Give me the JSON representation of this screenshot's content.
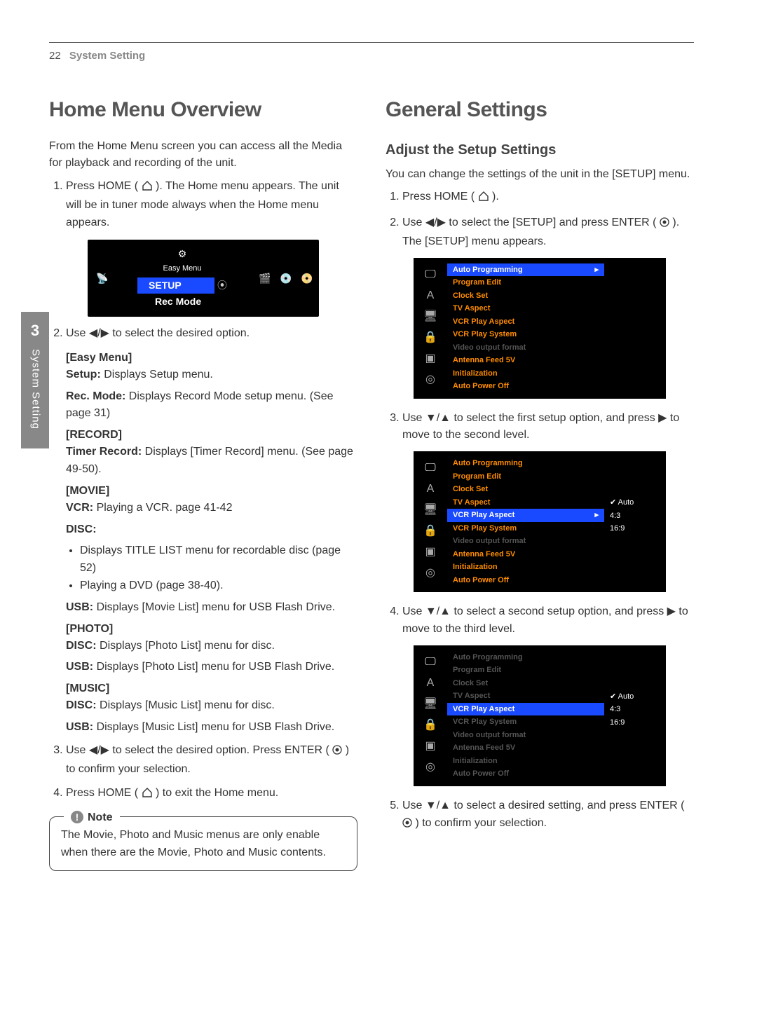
{
  "header": {
    "page_number": "22",
    "section": "System Setting"
  },
  "side_tab": {
    "number": "3",
    "label": "System Setting"
  },
  "left": {
    "h1": "Home Menu Overview",
    "intro": "From the Home Menu screen you can access all the Media for playback and recording of the unit.",
    "step1_a": "Press HOME (",
    "step1_b": "). The Home menu appears. The unit will be in tuner mode always when the Home menu appears.",
    "osd": {
      "easy_menu_label": "Easy Menu",
      "setup": "SETUP",
      "rec_mode": "Rec Mode"
    },
    "step2": "Use ◀/▶ to select the desired option.",
    "easy_menu": {
      "title": "[Easy Menu]",
      "setup_b": "Setup:",
      "setup_t": "Displays Setup menu.",
      "rec_b": "Rec. Mode:",
      "rec_t": "Displays Record Mode setup menu. (See page 31)"
    },
    "record": {
      "title": "[RECORD]",
      "timer_b": "Timer Record:",
      "timer_t": "Displays [Timer Record] menu. (See page 49-50)."
    },
    "movie": {
      "title": "[MOVIE]",
      "vcr_b": "VCR:",
      "vcr_t": "Playing a VCR. page 41-42",
      "disc_b": "DISC:",
      "disc_li1": "Displays TITLE LIST menu for recordable disc (page 52)",
      "disc_li2": "Playing a DVD (page 38-40).",
      "usb_b": "USB:",
      "usb_t": "Displays [Movie List] menu for USB Flash Drive."
    },
    "photo": {
      "title": "[PHOTO]",
      "disc_b": "DISC:",
      "disc_t": "Displays [Photo List] menu for disc.",
      "usb_b": "USB:",
      "usb_t": "Displays [Photo List] menu for USB Flash Drive."
    },
    "music": {
      "title": "[MUSIC]",
      "disc_b": "DISC:",
      "disc_t": "Displays [Music List] menu for disc.",
      "usb_b": "USB:",
      "usb_t": "Displays [Music List] menu for USB Flash Drive."
    },
    "step3_a": "Use ◀/▶ to select the desired option. Press ENTER (",
    "step3_b": ") to confirm your selection.",
    "step4_a": "Press HOME (",
    "step4_b": ") to exit the Home menu.",
    "note": {
      "label": "Note",
      "text": "The Movie, Photo and Music menus are only enable when there are the Movie, Photo and Music contents."
    }
  },
  "right": {
    "h1": "General Settings",
    "h2": "Adjust the Setup Settings",
    "intro": "You can change the settings of the unit in the [SETUP] menu.",
    "step1_a": "Press HOME (",
    "step1_b": ").",
    "step2_a": "Use ◀/▶ to select the [SETUP] and press ENTER (",
    "step2_b": "). The [SETUP] menu appears.",
    "step3": "Use ▼/▲ to select the first setup option, and press ▶ to move to the second level.",
    "step4": "Use ▼/▲ to select a second setup option, and press ▶ to move to the third level.",
    "step5_a": "Use ▼/▲ to select a desired setting, and press ENTER (",
    "step5_b": ") to confirm your selection.",
    "osd_items": {
      "auto_prog": "Auto Programming",
      "prog_edit": "Program Edit",
      "clock": "Clock Set",
      "tv_aspect": "TV Aspect",
      "vcr_aspect": "VCR Play Aspect",
      "vcr_system": "VCR Play System",
      "vid_out": "Video output format",
      "ant_feed": "Antenna Feed 5V",
      "init": "Initialization",
      "auto_off": "Auto Power Off",
      "opt_auto": "Auto",
      "opt_43": "4:3",
      "opt_169": "16:9"
    }
  }
}
